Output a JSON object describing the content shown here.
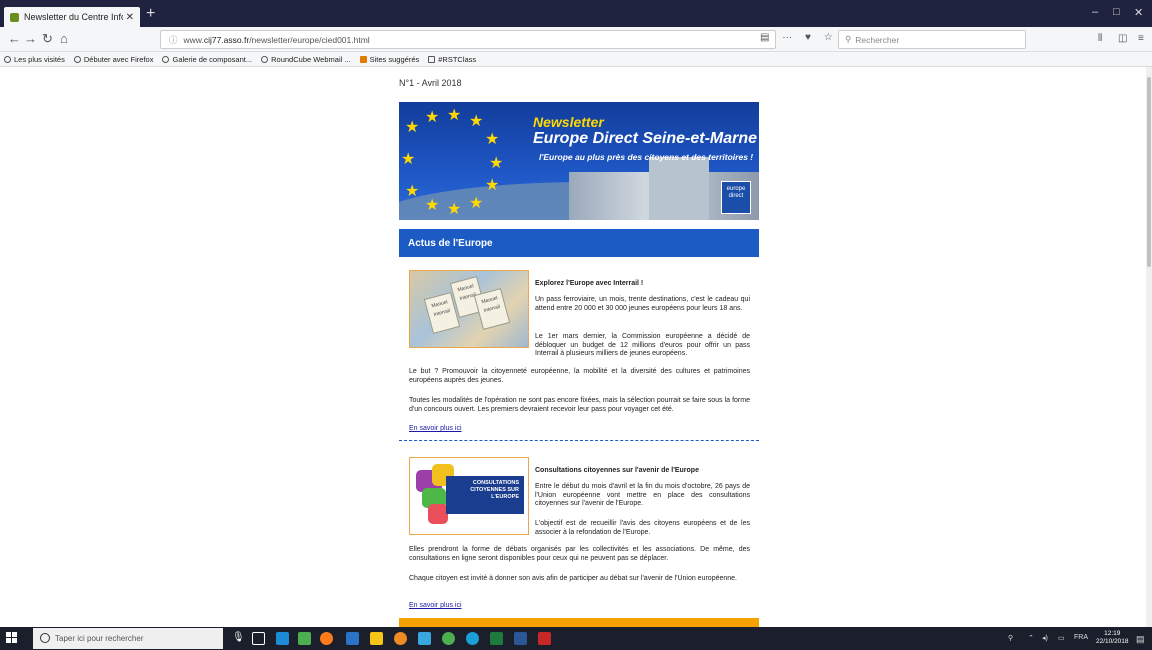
{
  "browser": {
    "tab_title": "Newsletter du Centre Informati",
    "new_tab": "+",
    "url_prefix": "www.",
    "url_domain": "cij77.asso.fr",
    "url_path": "/newsletter/europe/cied001.html",
    "search_placeholder": "Rechercher",
    "win_min": "–",
    "win_max": "□",
    "win_close": "✕"
  },
  "bookmarks": [
    {
      "label": "Les plus visités"
    },
    {
      "label": "Débuter avec Firefox"
    },
    {
      "label": "Galerie de composant..."
    },
    {
      "label": "RoundCube Webmail ..."
    },
    {
      "label": "Sites suggérés"
    },
    {
      "label": "#RSTClass"
    }
  ],
  "newsletter": {
    "issue": "N°1 - Avril 2018",
    "banner_title": "Newsletter",
    "banner_name": "Europe Direct Seine-et-Marne",
    "banner_tagline": "l'Europe au plus près des citoyens et des territoires !",
    "banner_logo": "europe direct",
    "section_title": "Actus de l'Europe",
    "articles": [
      {
        "thumb_text": "Manuel Interrail",
        "title": "Explorez l'Europe avec Interrail !",
        "p1": "Un pass ferroviaire, un mois, trente destinations, c'est le cadeau qui attend entre 20 000 et 30 000 jeunes européens pour leurs 18 ans.",
        "p2": "Le 1er mars dernier, la Commission européenne a décidé de débloquer un budget de 12 millions d'euros pour offrir un pass Interrail à plusieurs milliers de jeunes européens.",
        "p3": "Le but ? Promouvoir la citoyenneté européenne, la mobilité et la diversité des cultures et patrimoines européens auprès des jeunes.",
        "p4": "Toutes les modalités de l'opération ne sont pas encore fixées, mais la sélection pourrait se faire sous la forme d'un concours ouvert. Les premiers devraient recevoir leur pass pour voyager cet été.",
        "more": "En savoir plus ici"
      },
      {
        "thumb_text": "CONSULTATIONS CITOYENNES SUR L'EUROPE",
        "title": "Consultations citoyennes sur l'avenir de l'Europe",
        "p1": "Entre le début du mois d'avril et la fin du mois d'octobre, 26 pays de l'Union européenne vont mettre en place des consultations citoyennes sur l'avenir de l'Europe.",
        "p2": "L'objectif est de recueillir l'avis des citoyens européens et de les associer à la refondation de l'Europe.",
        "p3": "Elles prendront la forme de débats organisés par les collectivités et les associations. De même, des consultations en ligne seront disponibles pour ceux qui ne peuvent pas se déplacer.",
        "p4": "Chaque citoyen est invité à donner son avis afin de participer au débat sur l'avenir de l'Union européenne.",
        "more": "En savoir plus ici"
      }
    ]
  },
  "taskbar": {
    "search_placeholder": "Taper ici pour rechercher",
    "lang": "FRA",
    "time": "12:19",
    "date": "22/10/2018"
  },
  "colors": {
    "section_blue": "#1c5bc4",
    "accent_orange": "#f5a300",
    "link": "#1a1aa6"
  }
}
